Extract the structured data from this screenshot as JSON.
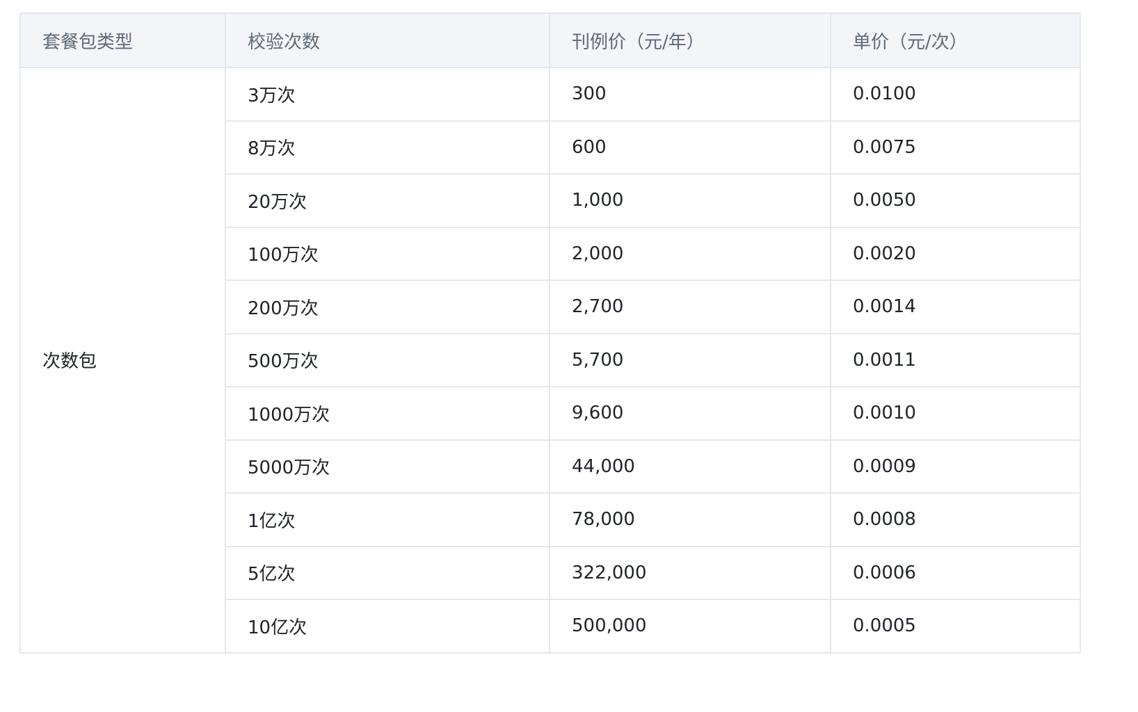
{
  "table": {
    "headers": [
      "套餐包类型",
      "校验次数",
      "刊例价（元/年）",
      "单价（元/次）"
    ],
    "package_type": "次数包",
    "rows": [
      {
        "count": "3万次",
        "list_price": "300",
        "unit_price": "0.0100"
      },
      {
        "count": "8万次",
        "list_price": "600",
        "unit_price": "0.0075"
      },
      {
        "count": "20万次",
        "list_price": "1,000",
        "unit_price": "0.0050"
      },
      {
        "count": "100万次",
        "list_price": "2,000",
        "unit_price": "0.0020"
      },
      {
        "count": "200万次",
        "list_price": "2,700",
        "unit_price": "0.0014"
      },
      {
        "count": "500万次",
        "list_price": "5,700",
        "unit_price": "0.0011"
      },
      {
        "count": "1000万次",
        "list_price": "9,600",
        "unit_price": "0.0010"
      },
      {
        "count": "5000万次",
        "list_price": "44,000",
        "unit_price": "0.0009"
      },
      {
        "count": "1亿次",
        "list_price": "78,000",
        "unit_price": "0.0008"
      },
      {
        "count": "5亿次",
        "list_price": "322,000",
        "unit_price": "0.0006"
      },
      {
        "count": "10亿次",
        "list_price": "500,000",
        "unit_price": "0.0005"
      }
    ]
  }
}
